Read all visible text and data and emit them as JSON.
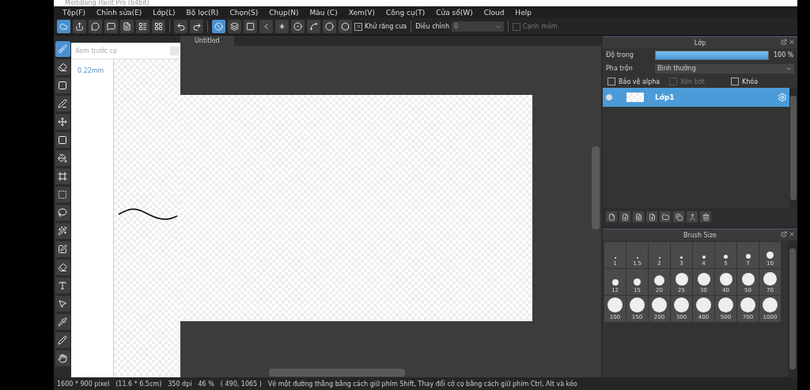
{
  "window": {
    "title": "MediBang Paint Pro (64bit)"
  },
  "menu": [
    "Tệp(F)",
    "Chỉnh sửa(E)",
    "Lớp(L)",
    "Bộ lọc(R)",
    "Chọn(S)",
    "Chụp(N)",
    "Màu (C)",
    "Xem(V)",
    "Công cụ(T)",
    "Cửa sổ(W)",
    "Cloud",
    "Help"
  ],
  "toolbar": {
    "anti_alias": {
      "label": "Khử răng cưa",
      "checked": true
    },
    "correction": {
      "label": "Điều chỉnh",
      "value": "0"
    },
    "soft_edge": {
      "label": "Cạnh mềm",
      "checked": false
    }
  },
  "toolbox": [
    {
      "selected": true
    },
    {
      "selected": false
    },
    {
      "selected": false
    },
    {
      "selected": false
    },
    {
      "selected": false
    },
    {
      "selected": false
    },
    {
      "selected": false
    },
    {
      "selected": false
    },
    {
      "selected": false
    },
    {
      "selected": false
    },
    {
      "selected": false
    },
    {
      "selected": false
    },
    {
      "selected": false
    },
    {
      "selected": false
    },
    {
      "selected": false
    },
    {
      "selected": false
    },
    {
      "selected": false
    },
    {
      "selected": false
    }
  ],
  "brush_preview": {
    "title": "Xem trước cọ",
    "size": "0.22mm"
  },
  "document_tab": {
    "label": "Untitled",
    "selected": true
  },
  "layer_panel": {
    "title": "Lớp",
    "opacity": {
      "label": "Độ trong",
      "level": 1.0,
      "reading": "100 %"
    },
    "blend": {
      "label": "Pha trộn",
      "value": "Bình thường"
    },
    "options": [
      {
        "label": "Bảo vệ alpha",
        "checked": false,
        "disabled": false
      },
      {
        "label": "Xén bớt",
        "checked": false,
        "disabled": true
      },
      {
        "label": "Khóa",
        "checked": false,
        "disabled": false
      }
    ],
    "layers": [
      {
        "name": "Lớp1",
        "selected": true,
        "visible": true
      }
    ]
  },
  "brush_size_panel": {
    "title": "Brush Size",
    "sizes": [
      "1",
      "1.5",
      "2",
      "3",
      "4",
      "5",
      "7",
      "10",
      "12",
      "15",
      "20",
      "25",
      "30",
      "40",
      "50",
      "70",
      "100",
      "150",
      "200",
      "300",
      "400",
      "500",
      "700",
      "1000"
    ]
  },
  "status_bar": [
    "1600 * 900 pixel",
    "(11.6 * 6.5cm)",
    "350 dpi",
    "46 %",
    "( 490, 1065 )",
    "Vẽ một đường thẳng bằng cách giữ phím Shift, Thay đổi cỡ cọ bằng cách giữ phím Ctrl, Alt và kéo"
  ]
}
